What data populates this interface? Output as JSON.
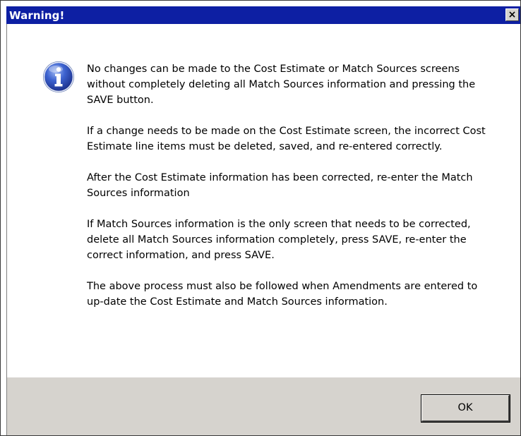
{
  "window": {
    "title": "Warning!",
    "close_label": "×",
    "title_bar_color": "#0d1fa3"
  },
  "icon": {
    "name": "information-icon",
    "glyph": "i",
    "color": "#2a4fc2"
  },
  "message": {
    "paragraphs": [
      "No changes can be made to the Cost Estimate or Match Sources screens without completely deleting all Match Sources information and pressing the SAVE button.",
      "If a change needs to be made on the Cost Estimate screen, the incorrect Cost Estimate line items must be deleted, saved, and re-entered correctly.",
      "After the Cost Estimate information has been corrected, re-enter the Match Sources information",
      "If Match Sources information is the only screen that needs to be corrected, delete all Match Sources information completely, press SAVE, re-enter the correct information, and press SAVE.",
      "The above process must also be followed when Amendments are entered to up-date the Cost Estimate and Match Sources information."
    ]
  },
  "buttons": {
    "ok_label": "OK"
  }
}
